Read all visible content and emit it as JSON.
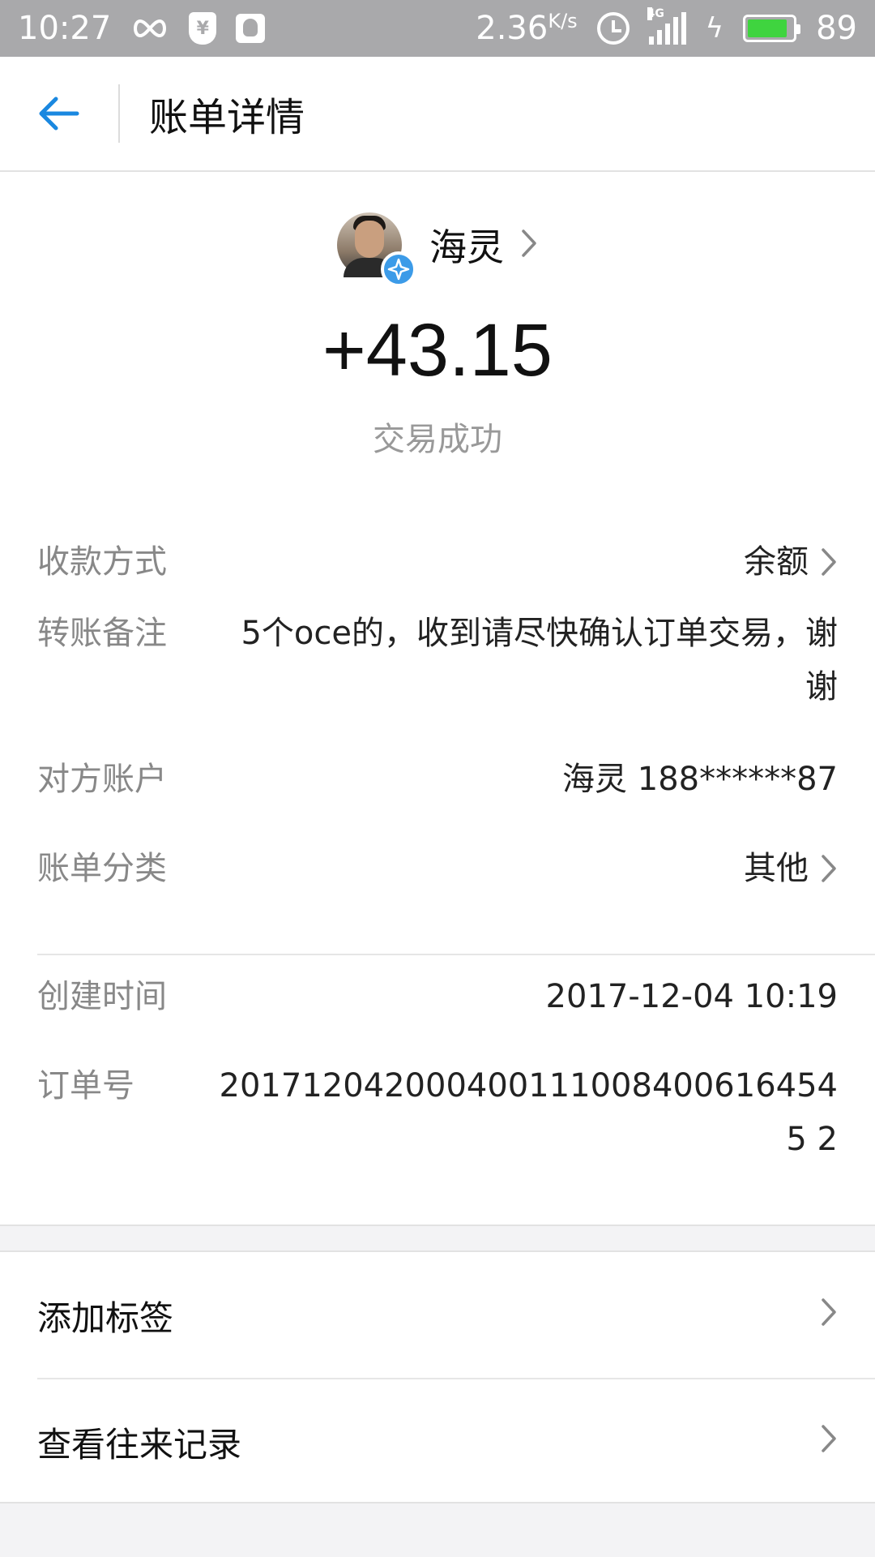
{
  "status_bar": {
    "time": "10:27",
    "speed_value": "2.36",
    "speed_unit": "K/s",
    "network": "4G",
    "battery": "89",
    "battery_level": 0.89
  },
  "header": {
    "title": "账单详情"
  },
  "payee": {
    "name": "海灵"
  },
  "amount": "+43.15",
  "trade_status": "交易成功",
  "details": [
    {
      "label": "收款方式",
      "value": "余额"
    },
    {
      "label": "转账备注",
      "value": "5个oce的，收到请尽快确认订单交易，谢谢"
    },
    {
      "label": "对方账户",
      "value": "海灵 188******87"
    },
    {
      "label": "账单分类",
      "value": "其他"
    },
    {
      "label": "创建时间",
      "value": "2017-12-04 10:19"
    },
    {
      "label": "订单号",
      "value": "2017120420004001110084006164545 2"
    }
  ],
  "actions": [
    {
      "label": "添加标签"
    },
    {
      "label": "查看往来记录"
    }
  ],
  "colors": {
    "accent": "#1a88e0",
    "status_bar": "#a9a9ab",
    "battery": "#3fd43f",
    "badge": "#3c9be8"
  }
}
